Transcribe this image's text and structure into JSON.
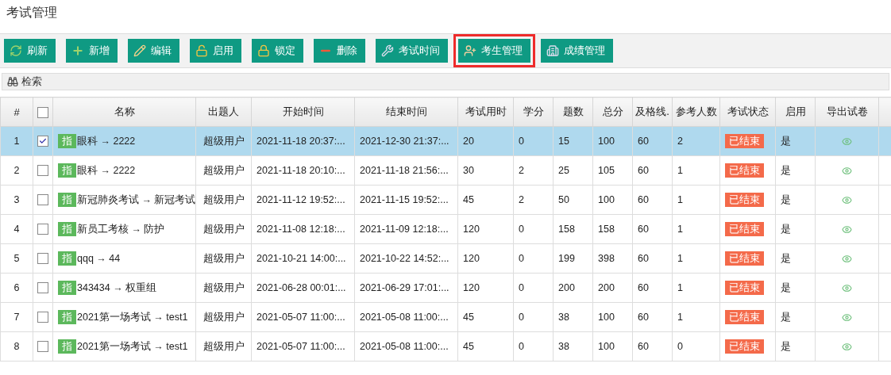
{
  "page_title": "考试管理",
  "toolbar": [
    {
      "kind": "refresh",
      "label": "刷新",
      "highlighted": false
    },
    {
      "kind": "add",
      "label": "新增",
      "highlighted": false
    },
    {
      "kind": "edit",
      "label": "编辑",
      "highlighted": false
    },
    {
      "kind": "enable",
      "label": "启用",
      "highlighted": false
    },
    {
      "kind": "lock",
      "label": "锁定",
      "highlighted": false
    },
    {
      "kind": "delete",
      "label": "删除",
      "highlighted": false
    },
    {
      "kind": "time",
      "label": "考试时间",
      "highlighted": false
    },
    {
      "kind": "students",
      "label": "考生管理",
      "highlighted": true
    },
    {
      "kind": "scores",
      "label": "成绩管理",
      "highlighted": false
    }
  ],
  "search_bar": {
    "label": "检索"
  },
  "table": {
    "columns": [
      "#",
      "名称",
      "出题人",
      "开始时间",
      "结束时间",
      "考试用时",
      "学分",
      "题数",
      "总分",
      "及格线.",
      "参考人数",
      "考试状态",
      "启用",
      "导出试卷"
    ],
    "select_all_checked": false,
    "rows": [
      {
        "index": "1",
        "selected": true,
        "checked": true,
        "tag": "指",
        "name": "眼科 → 2222",
        "author": "超级用户",
        "start": "2021-11-18 20:37:...",
        "end": "2021-12-30 21:37:...",
        "duration": "20",
        "credit": "0",
        "questions": "15",
        "total": "100",
        "pass": "60",
        "participants": "2",
        "status": "已结束",
        "enabled": "是"
      },
      {
        "index": "2",
        "selected": false,
        "checked": false,
        "tag": "指",
        "name": "眼科 → 2222",
        "author": "超级用户",
        "start": "2021-11-18 20:10:...",
        "end": "2021-11-18 21:56:...",
        "duration": "30",
        "credit": "2",
        "questions": "25",
        "total": "105",
        "pass": "60",
        "participants": "1",
        "status": "已结束",
        "enabled": "是"
      },
      {
        "index": "3",
        "selected": false,
        "checked": false,
        "tag": "指",
        "name": "新冠肺炎考试 → 新冠考试",
        "author": "超级用户",
        "start": "2021-11-12 19:52:...",
        "end": "2021-11-15 19:52:...",
        "duration": "45",
        "credit": "2",
        "questions": "50",
        "total": "100",
        "pass": "60",
        "participants": "1",
        "status": "已结束",
        "enabled": "是"
      },
      {
        "index": "4",
        "selected": false,
        "checked": false,
        "tag": "指",
        "name": "新员工考核 → 防护",
        "author": "超级用户",
        "start": "2021-11-08 12:18:...",
        "end": "2021-11-09 12:18:...",
        "duration": "120",
        "credit": "0",
        "questions": "158",
        "total": "158",
        "pass": "60",
        "participants": "1",
        "status": "已结束",
        "enabled": "是"
      },
      {
        "index": "5",
        "selected": false,
        "checked": false,
        "tag": "指",
        "name": "qqq → 44",
        "author": "超级用户",
        "start": "2021-10-21 14:00:...",
        "end": "2021-10-22 14:52:...",
        "duration": "120",
        "credit": "0",
        "questions": "199",
        "total": "398",
        "pass": "60",
        "participants": "1",
        "status": "已结束",
        "enabled": "是"
      },
      {
        "index": "6",
        "selected": false,
        "checked": false,
        "tag": "指",
        "name": "343434 → 权重组",
        "author": "超级用户",
        "start": "2021-06-28 00:01:...",
        "end": "2021-06-29 17:01:...",
        "duration": "120",
        "credit": "0",
        "questions": "200",
        "total": "200",
        "pass": "60",
        "participants": "1",
        "status": "已结束",
        "enabled": "是"
      },
      {
        "index": "7",
        "selected": false,
        "checked": false,
        "tag": "指",
        "name": "2021第一场考试 → test1",
        "author": "超级用户",
        "start": "2021-05-07 11:00:...",
        "end": "2021-05-08 11:00:...",
        "duration": "45",
        "credit": "0",
        "questions": "38",
        "total": "100",
        "pass": "60",
        "participants": "1",
        "status": "已结束",
        "enabled": "是"
      },
      {
        "index": "8",
        "selected": false,
        "checked": false,
        "tag": "指",
        "name": "2021第一场考试 → test1",
        "author": "超级用户",
        "start": "2021-05-07 11:00:...",
        "end": "2021-05-08 11:00:...",
        "duration": "45",
        "credit": "0",
        "questions": "38",
        "total": "100",
        "pass": "60",
        "participants": "0",
        "status": "已结束",
        "enabled": "是"
      }
    ]
  }
}
